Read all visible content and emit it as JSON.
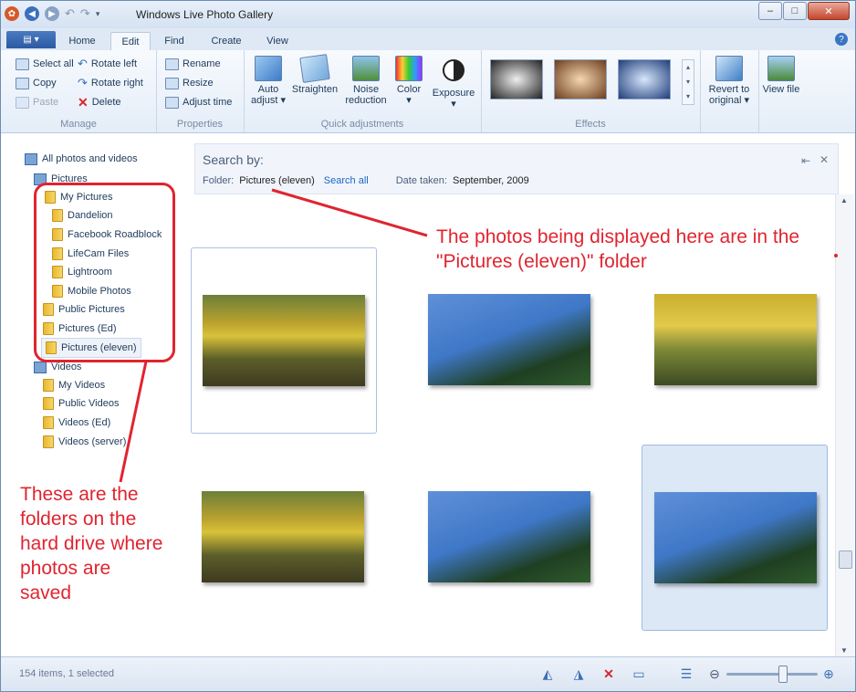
{
  "window": {
    "title": "Windows Live Photo Gallery"
  },
  "tabs": [
    "Home",
    "Edit",
    "Find",
    "Create",
    "View"
  ],
  "active_tab": "Edit",
  "ribbon": {
    "manage": {
      "label": "Manage",
      "select_all": "Select all",
      "copy": "Copy",
      "paste": "Paste",
      "rotate_left": "Rotate left",
      "rotate_right": "Rotate right",
      "delete": "Delete"
    },
    "properties": {
      "label": "Properties",
      "rename": "Rename",
      "resize": "Resize",
      "adjust_time": "Adjust time"
    },
    "quick": {
      "label": "Quick adjustments",
      "auto_adjust": "Auto adjust",
      "straighten": "Straighten",
      "noise_reduction": "Noise reduction",
      "color": "Color",
      "exposure": "Exposure"
    },
    "effects": {
      "label": "Effects"
    },
    "revert": "Revert to original",
    "view_file": "View file"
  },
  "nav": {
    "all": "All photos and videos",
    "pictures": "Pictures",
    "my_pictures": "My Pictures",
    "sub": [
      "Dandelion",
      "Facebook Roadblock",
      "LifeCam Files",
      "Lightroom",
      "Mobile Photos"
    ],
    "public_pictures": "Public Pictures",
    "pictures_ed": "Pictures (Ed)",
    "pictures_eleven": "Pictures (eleven)",
    "videos": "Videos",
    "video_items": [
      "My Videos",
      "Public Videos",
      "Videos (Ed)",
      "Videos (server)"
    ]
  },
  "search": {
    "title": "Search by:",
    "folder_label": "Folder:",
    "folder_value": "Pictures (eleven)",
    "search_all": "Search all",
    "date_label": "Date taken:",
    "date_value": "September, 2009"
  },
  "status": {
    "text": "154 items, 1 selected"
  },
  "annotations": {
    "right": "The photos being displayed here are in the \"Pictures (eleven)\" folder",
    "left": "These are the folders on the hard drive where photos are saved"
  },
  "colors": {
    "annotation": "#e0242f",
    "accent": "#2b5aa3"
  }
}
